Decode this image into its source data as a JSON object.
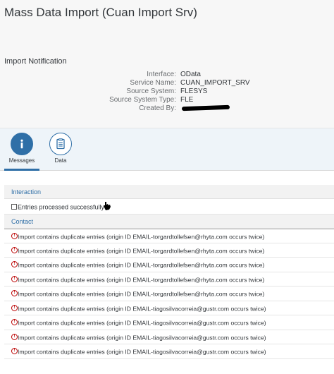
{
  "app": {
    "title": "Mass Data Import (Cuan Import Srv)",
    "subtitle": "Import Notification"
  },
  "attributes": [
    {
      "label": "Interface:",
      "value": "OData"
    },
    {
      "label": "Service Name:",
      "value": "CUAN_IMPORT_SRV"
    },
    {
      "label": "Source System:",
      "value": "FLESYS"
    },
    {
      "label": "Source System Type:",
      "value": "FLE"
    },
    {
      "label": "Created By:",
      "value": ""
    }
  ],
  "tabs": [
    {
      "label": "Messages",
      "icon": "info-icon",
      "selected": true
    },
    {
      "label": "Data",
      "icon": "document-icon",
      "selected": false
    }
  ],
  "groups": {
    "interaction": {
      "title": "Interaction",
      "message": "Entries processed successfully"
    },
    "contact": {
      "title": "Contact",
      "messages": [
        "Import contains duplicate entries (origin ID EMAIL-torgardtollefsen@rhyta.com occurs twice)",
        "Import contains duplicate entries (origin ID EMAIL-torgardtollefsen@rhyta.com occurs twice)",
        "Import contains duplicate entries (origin ID EMAIL-torgardtollefsen@rhyta.com occurs twice)",
        "Import contains duplicate entries (origin ID EMAIL-torgardtollefsen@rhyta.com occurs twice)",
        "Import contains duplicate entries (origin ID EMAIL-torgardtollefsen@rhyta.com occurs twice)",
        "Import contains duplicate entries (origin ID EMAIL-tiagosilvacorreia@gustr.com occurs twice)",
        "Import contains duplicate entries (origin ID EMAIL-tiagosilvacorreia@gustr.com occurs twice)",
        "Import contains duplicate entries (origin ID EMAIL-tiagosilvacorreia@gustr.com occurs twice)",
        "Import contains duplicate entries (origin ID EMAIL-tiagosilvacorreia@gustr.com occurs twice)"
      ]
    }
  },
  "colors": {
    "accent": "#2f6fa7",
    "error": "#bb0000",
    "header_bg": "#f7f7f7",
    "tabbar_bg": "#eef4f9"
  }
}
